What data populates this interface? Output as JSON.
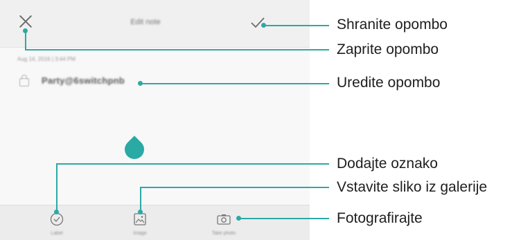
{
  "titlebar": {
    "title": "Edit note"
  },
  "note": {
    "date": "Aug 14, 2016 | 3:44 PM",
    "text": "Party@6switchpnb"
  },
  "bottombar": {
    "tags_label": "Label",
    "image_label": "Image",
    "camera_label": "Take photo"
  },
  "callouts": {
    "save_note": "Shranite opombo",
    "close_note": "Zaprite opombo",
    "edit_note": "Uredite opombo",
    "add_tag": "Dodajte oznako",
    "insert_image": "Vstavite sliko iz galerije",
    "take_photo": "Fotografirajte"
  },
  "colors": {
    "accent": "#2ba9a5",
    "titlebar_bg": "#f0f0f0",
    "bottombar_bg": "#ececec",
    "content_bg": "#f8f8f8"
  }
}
